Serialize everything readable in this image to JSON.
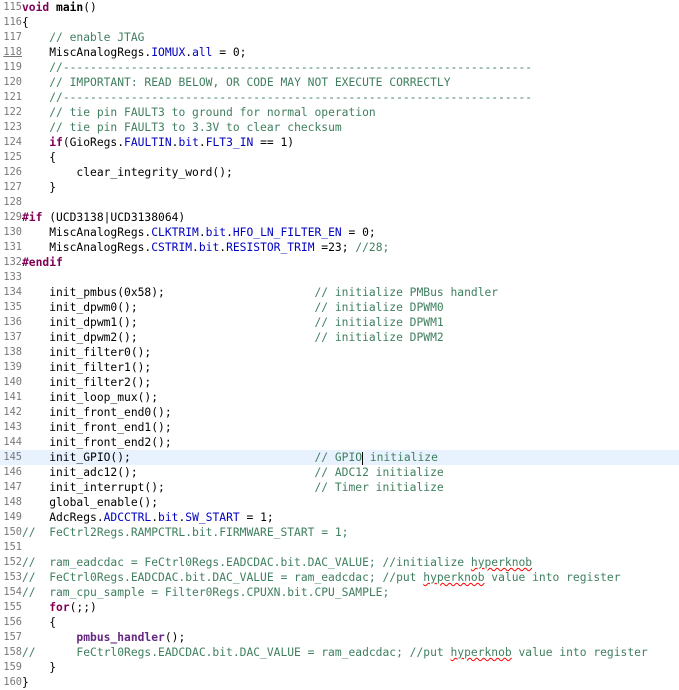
{
  "editor": {
    "lines": [
      {
        "n": "115",
        "tokens": [
          {
            "t": "kw",
            "v": "void"
          },
          {
            "t": "",
            "v": " "
          },
          {
            "t": "fn",
            "v": "main"
          },
          {
            "t": "",
            "v": "()"
          }
        ]
      },
      {
        "n": "116",
        "tokens": [
          {
            "t": "",
            "v": "{"
          }
        ]
      },
      {
        "n": "117",
        "tokens": [
          {
            "t": "",
            "v": "    "
          },
          {
            "t": "cm",
            "v": "// enable JTAG"
          }
        ]
      },
      {
        "n": "118",
        "underline": true,
        "tokens": [
          {
            "t": "",
            "v": "    MiscAnalogRegs."
          },
          {
            "t": "fld",
            "v": "IOMUX"
          },
          {
            "t": "",
            "v": "."
          },
          {
            "t": "fld",
            "v": "all"
          },
          {
            "t": "",
            "v": " = 0;"
          }
        ]
      },
      {
        "n": "119",
        "tokens": [
          {
            "t": "",
            "v": "    "
          },
          {
            "t": "cm",
            "v": "//---------------------------------------------------------------------"
          }
        ]
      },
      {
        "n": "120",
        "tokens": [
          {
            "t": "",
            "v": "    "
          },
          {
            "t": "cm",
            "v": "// IMPORTANT: READ BELOW, OR CODE MAY NOT EXECUTE CORRECTLY"
          }
        ]
      },
      {
        "n": "121",
        "tokens": [
          {
            "t": "",
            "v": "    "
          },
          {
            "t": "cm",
            "v": "//---------------------------------------------------------------------"
          }
        ]
      },
      {
        "n": "122",
        "tokens": [
          {
            "t": "",
            "v": "    "
          },
          {
            "t": "cm",
            "v": "// tie pin FAULT3 to ground for normal operation"
          }
        ]
      },
      {
        "n": "123",
        "tokens": [
          {
            "t": "",
            "v": "    "
          },
          {
            "t": "cm",
            "v": "// tie pin FAULT3 to 3.3V to clear checksum"
          }
        ]
      },
      {
        "n": "124",
        "tokens": [
          {
            "t": "",
            "v": "    "
          },
          {
            "t": "kw",
            "v": "if"
          },
          {
            "t": "",
            "v": "(GioRegs."
          },
          {
            "t": "fld",
            "v": "FAULTIN"
          },
          {
            "t": "",
            "v": "."
          },
          {
            "t": "fld",
            "v": "bit"
          },
          {
            "t": "",
            "v": "."
          },
          {
            "t": "fld",
            "v": "FLT3_IN"
          },
          {
            "t": "",
            "v": " == 1)"
          }
        ]
      },
      {
        "n": "125",
        "tokens": [
          {
            "t": "",
            "v": "    {"
          }
        ]
      },
      {
        "n": "126",
        "tokens": [
          {
            "t": "",
            "v": "        clear_integrity_word();"
          }
        ]
      },
      {
        "n": "127",
        "tokens": [
          {
            "t": "",
            "v": "    }"
          }
        ]
      },
      {
        "n": "128",
        "tokens": []
      },
      {
        "n": "129",
        "tokens": [
          {
            "t": "pp",
            "v": "#if"
          },
          {
            "t": "",
            "v": " (UCD3138|UCD3138064)"
          }
        ]
      },
      {
        "n": "130",
        "tokens": [
          {
            "t": "",
            "v": "    MiscAnalogRegs."
          },
          {
            "t": "fld",
            "v": "CLKTRIM"
          },
          {
            "t": "",
            "v": "."
          },
          {
            "t": "fld",
            "v": "bit"
          },
          {
            "t": "",
            "v": "."
          },
          {
            "t": "fld",
            "v": "HFO_LN_FILTER_EN"
          },
          {
            "t": "",
            "v": " = 0;"
          }
        ]
      },
      {
        "n": "131",
        "tokens": [
          {
            "t": "",
            "v": "    MiscAnalogRegs."
          },
          {
            "t": "fld",
            "v": "CSTRIM"
          },
          {
            "t": "",
            "v": "."
          },
          {
            "t": "fld",
            "v": "bit"
          },
          {
            "t": "",
            "v": "."
          },
          {
            "t": "fld",
            "v": "RESISTOR_TRIM"
          },
          {
            "t": "",
            "v": " =23; "
          },
          {
            "t": "cm",
            "v": "//28;"
          }
        ]
      },
      {
        "n": "132",
        "tokens": [
          {
            "t": "pp",
            "v": "#endif"
          }
        ]
      },
      {
        "n": "133",
        "tokens": []
      },
      {
        "n": "134",
        "tokens": [
          {
            "t": "",
            "v": "    init_pmbus(0x58);                      "
          },
          {
            "t": "cm",
            "v": "// initialize PMBus handler"
          }
        ]
      },
      {
        "n": "135",
        "tokens": [
          {
            "t": "",
            "v": "    init_dpwm0();                          "
          },
          {
            "t": "cm",
            "v": "// initialize DPWM0"
          }
        ]
      },
      {
        "n": "136",
        "tokens": [
          {
            "t": "",
            "v": "    init_dpwm1();                          "
          },
          {
            "t": "cm",
            "v": "// initialize DPWM1"
          }
        ]
      },
      {
        "n": "137",
        "tokens": [
          {
            "t": "",
            "v": "    init_dpwm2();                          "
          },
          {
            "t": "cm",
            "v": "// initialize DPWM2"
          }
        ]
      },
      {
        "n": "138",
        "tokens": [
          {
            "t": "",
            "v": "    init_filter0();"
          }
        ]
      },
      {
        "n": "139",
        "tokens": [
          {
            "t": "",
            "v": "    init_filter1();"
          }
        ]
      },
      {
        "n": "140",
        "tokens": [
          {
            "t": "",
            "v": "    init_filter2();"
          }
        ]
      },
      {
        "n": "141",
        "tokens": [
          {
            "t": "",
            "v": "    init_loop_mux();"
          }
        ]
      },
      {
        "n": "142",
        "tokens": [
          {
            "t": "",
            "v": "    init_front_end0();"
          }
        ]
      },
      {
        "n": "143",
        "tokens": [
          {
            "t": "",
            "v": "    init_front_end1();"
          }
        ]
      },
      {
        "n": "144",
        "tokens": [
          {
            "t": "",
            "v": "    init_front_end2();"
          }
        ]
      },
      {
        "n": "145",
        "current": true,
        "tokens": [
          {
            "t": "",
            "v": "    init_GPIO();                           "
          },
          {
            "t": "cm",
            "v": "// GPIO"
          },
          {
            "t": "caret",
            "v": ""
          },
          {
            "t": "cm",
            "v": " initialize"
          }
        ]
      },
      {
        "n": "146",
        "tokens": [
          {
            "t": "",
            "v": "    init_adc12();                          "
          },
          {
            "t": "cm",
            "v": "// ADC12 initialize"
          }
        ]
      },
      {
        "n": "147",
        "tokens": [
          {
            "t": "",
            "v": "    init_interrupt();                      "
          },
          {
            "t": "cm",
            "v": "// Timer initialize"
          }
        ]
      },
      {
        "n": "148",
        "tokens": [
          {
            "t": "",
            "v": "    global_enable();"
          }
        ]
      },
      {
        "n": "149",
        "tokens": [
          {
            "t": "",
            "v": "    AdcRegs."
          },
          {
            "t": "fld",
            "v": "ADCCTRL"
          },
          {
            "t": "",
            "v": "."
          },
          {
            "t": "fld",
            "v": "bit"
          },
          {
            "t": "",
            "v": "."
          },
          {
            "t": "fld",
            "v": "SW_START"
          },
          {
            "t": "",
            "v": " = 1;"
          }
        ]
      },
      {
        "n": "150",
        "tokens": [
          {
            "t": "cm",
            "v": "//  FeCtrl2Regs.RAMPCTRL.bit.FIRMWARE_START = 1;"
          }
        ]
      },
      {
        "n": "151",
        "tokens": []
      },
      {
        "n": "152",
        "tokens": [
          {
            "t": "cm",
            "v": "//  ram_eadcdac = FeCtrl0Regs.EADCDAC.bit.DAC_VALUE; //initialize "
          },
          {
            "t": "cmsp",
            "v": "hyperknob"
          }
        ]
      },
      {
        "n": "153",
        "tokens": [
          {
            "t": "cm",
            "v": "//  FeCtrl0Regs.EADCDAC.bit.DAC_VALUE = ram_eadcdac; //put "
          },
          {
            "t": "cmsp",
            "v": "hyperknob"
          },
          {
            "t": "cm",
            "v": " value into register"
          }
        ]
      },
      {
        "n": "154",
        "tokens": [
          {
            "t": "cm",
            "v": "//  ram_cpu_sample = Filter0Regs.CPUXN.bit.CPU_SAMPLE;"
          }
        ]
      },
      {
        "n": "155",
        "tokens": [
          {
            "t": "",
            "v": "    "
          },
          {
            "t": "kw",
            "v": "for"
          },
          {
            "t": "",
            "v": "(;;)"
          }
        ]
      },
      {
        "n": "156",
        "tokens": [
          {
            "t": "",
            "v": "    {"
          }
        ]
      },
      {
        "n": "157",
        "tokens": [
          {
            "t": "",
            "v": "        "
          },
          {
            "t": "fn-pmbus",
            "v": "pmbus_handler"
          },
          {
            "t": "",
            "v": "();"
          }
        ]
      },
      {
        "n": "158",
        "tokens": [
          {
            "t": "cm",
            "v": "//      FeCtrl0Regs.EADCDAC.bit.DAC_VALUE = ram_eadcdac; //put "
          },
          {
            "t": "cmsp",
            "v": "hyperknob"
          },
          {
            "t": "cm",
            "v": " value into register"
          }
        ]
      },
      {
        "n": "159",
        "tokens": [
          {
            "t": "",
            "v": "    }"
          }
        ]
      },
      {
        "n": "160",
        "tokens": [
          {
            "t": "",
            "v": "}"
          }
        ]
      }
    ]
  }
}
